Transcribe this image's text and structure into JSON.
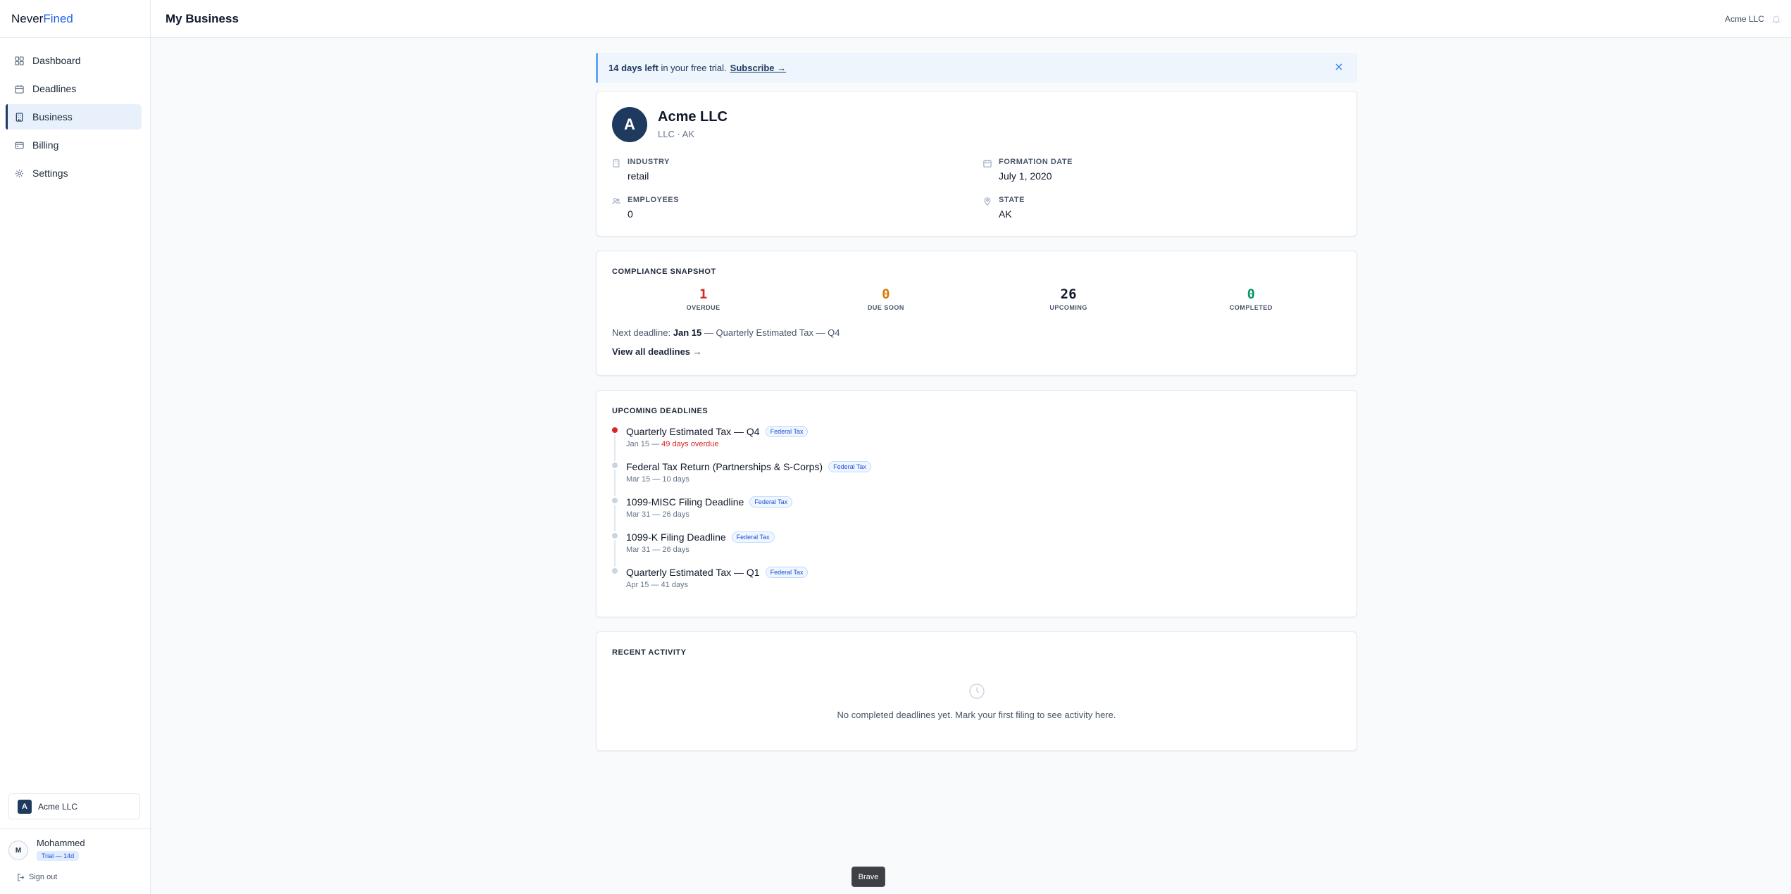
{
  "app": {
    "logo_part1": "Never",
    "logo_part2": "Fined"
  },
  "sidebar": {
    "items": [
      {
        "label": "Dashboard",
        "icon": "grid-icon",
        "active": false
      },
      {
        "label": "Deadlines",
        "icon": "calendar-icon",
        "active": false
      },
      {
        "label": "Business",
        "icon": "building-icon",
        "active": true
      },
      {
        "label": "Billing",
        "icon": "credit-card-icon",
        "active": false
      },
      {
        "label": "Settings",
        "icon": "gear-icon",
        "active": false
      }
    ],
    "company": {
      "initial": "A",
      "name": "Acme LLC"
    },
    "user": {
      "initial": "M",
      "name": "Mohammed",
      "badge": "Trial — 14d"
    },
    "signout_label": "Sign out"
  },
  "header": {
    "title": "My Business",
    "company": "Acme LLC",
    "bell_icon": "bell-icon"
  },
  "banner": {
    "days_left": "14 days left",
    "text": "in your free trial.",
    "subscribe_label": "Subscribe →"
  },
  "profile": {
    "initial": "A",
    "name": "Acme LLC",
    "subtitle": "LLC · AK",
    "fields": {
      "industry": {
        "label": "Industry",
        "value": "retail"
      },
      "formation_date": {
        "label": "Formation Date",
        "value": "July 1, 2020"
      },
      "employees": {
        "label": "Employees",
        "value": "0"
      },
      "state": {
        "label": "State",
        "value": "AK"
      }
    }
  },
  "snapshot": {
    "title": "Compliance Snapshot",
    "stats": [
      {
        "value": "1",
        "label": "Overdue",
        "color": "#dc2626"
      },
      {
        "value": "0",
        "label": "Due Soon",
        "color": "#d97706"
      },
      {
        "value": "26",
        "label": "Upcoming",
        "color": "#0f172a"
      },
      {
        "value": "0",
        "label": "Completed",
        "color": "#059669"
      }
    ],
    "next_prefix": "Next deadline:",
    "next_date": "Jan 15",
    "next_rest": "— Quarterly Estimated Tax — Q4",
    "view_all_label": "View all deadlines →"
  },
  "upcoming": {
    "title": "Upcoming Deadlines",
    "items": [
      {
        "title": "Quarterly Estimated Tax — Q4",
        "tag": "Federal Tax",
        "date": "Jan 15 —",
        "status": "49 days overdue",
        "overdue": true
      },
      {
        "title": "Federal Tax Return (Partnerships & S-Corps)",
        "tag": "Federal Tax",
        "date": "Mar 15 —",
        "status": "10 days",
        "overdue": false
      },
      {
        "title": "1099-MISC Filing Deadline",
        "tag": "Federal Tax",
        "date": "Mar 31 —",
        "status": "26 days",
        "overdue": false
      },
      {
        "title": "1099-K Filing Deadline",
        "tag": "Federal Tax",
        "date": "Mar 31 —",
        "status": "26 days",
        "overdue": false
      },
      {
        "title": "Quarterly Estimated Tax — Q1",
        "tag": "Federal Tax",
        "date": "Apr 15 —",
        "status": "41 days",
        "overdue": false
      }
    ]
  },
  "activity": {
    "title": "Recent Activity",
    "empty_text": "No completed deadlines yet. Mark your first filing to see activity here."
  },
  "tooltip": {
    "text": "Brave"
  }
}
